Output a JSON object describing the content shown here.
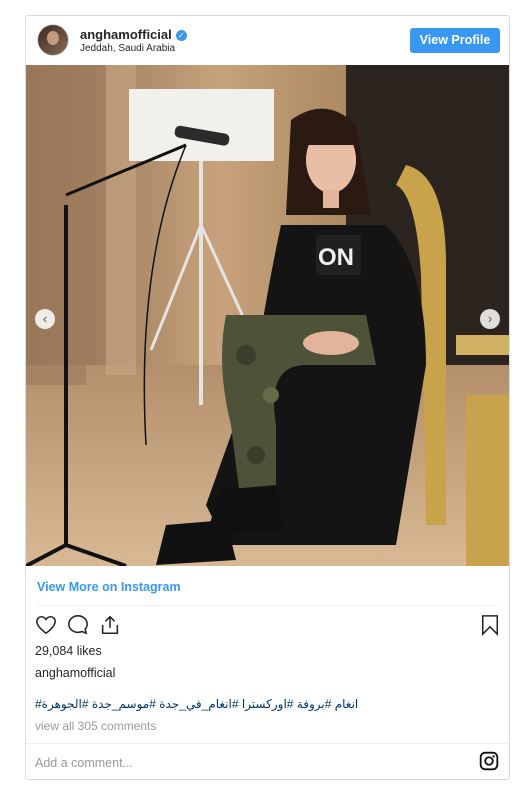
{
  "header": {
    "username": "anghamofficial",
    "location": "Jeddah, Saudi Arabia",
    "view_profile": "View Profile"
  },
  "view_more": "View More on Instagram",
  "likes": "29,084 likes",
  "owner": "anghamofficial",
  "hashtags": "انغام  #بروفة #اوركسترا #انغام_في_جدة #موسم_جدة #الجوهرة#",
  "view_comments": "view all 305 comments",
  "add_comment": "Add a comment...",
  "colors": {
    "accent": "#3897f0",
    "hashtag": "#003569",
    "muted": "#999999"
  },
  "icons": [
    "verified-badge-icon",
    "chevron-left-icon",
    "chevron-right-icon",
    "heart-icon",
    "comment-icon",
    "share-icon",
    "bookmark-icon",
    "instagram-icon"
  ]
}
